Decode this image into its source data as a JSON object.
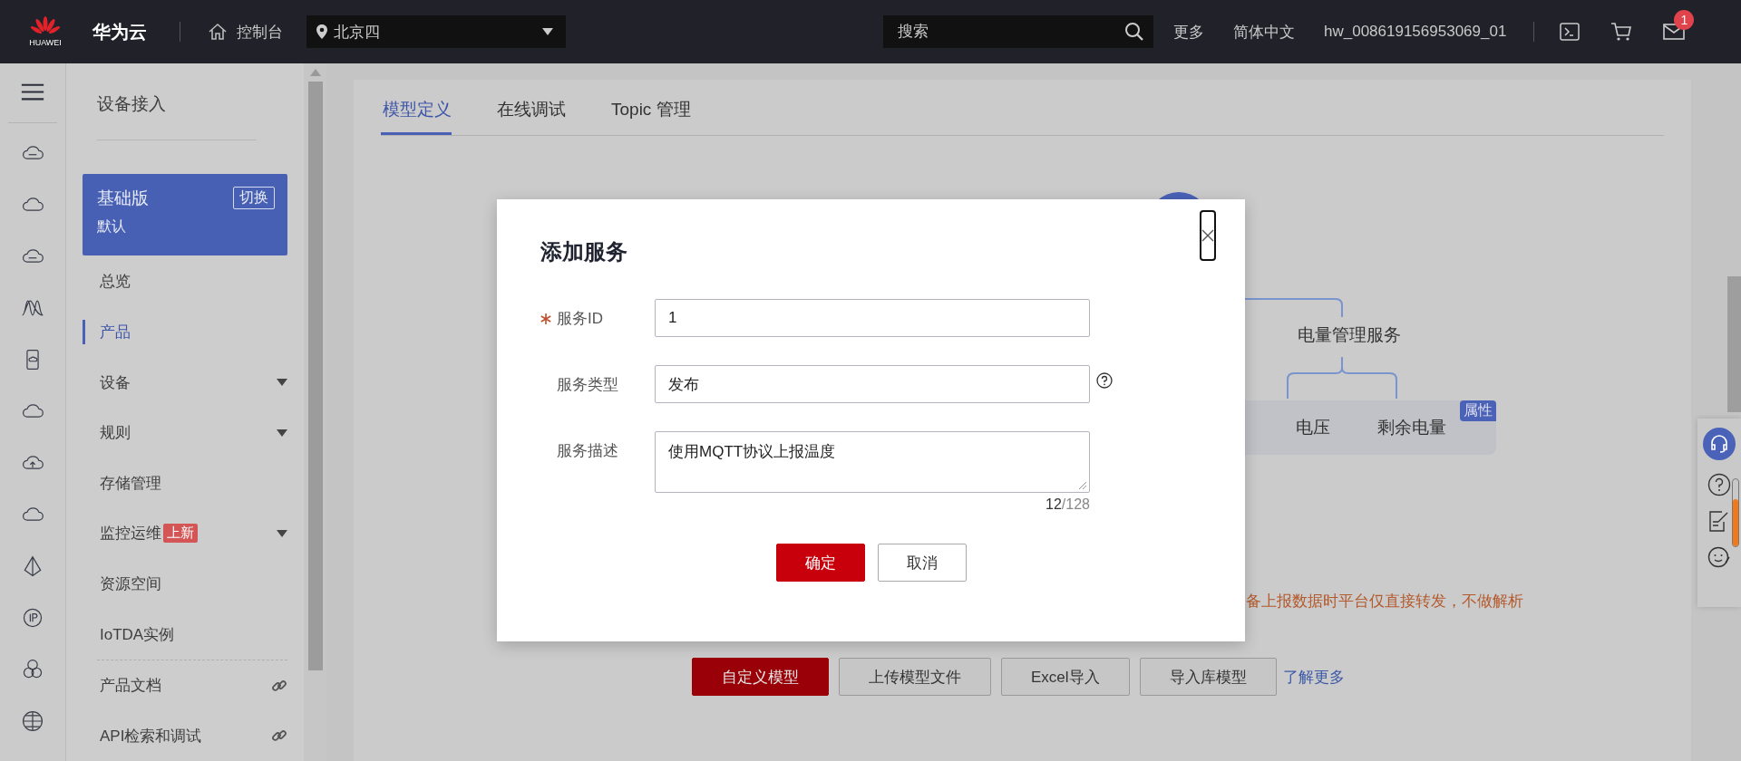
{
  "top_bar": {
    "logo_text": "HUAWEI",
    "brand": "华为云",
    "console": "控制台",
    "region": "北京四",
    "search": {
      "placeholder": "搜索"
    },
    "links": [
      "更多",
      "简体中文",
      "hw_008619156953069_01"
    ],
    "notification_count": "1"
  },
  "nav": {
    "title": "设备接入",
    "edition": {
      "name": "基础版",
      "switch": "切换",
      "instance": "默认"
    },
    "items": [
      {
        "label": "总览",
        "kind": "plain",
        "selected": false
      },
      {
        "label": "产品",
        "kind": "plain",
        "selected": true
      },
      {
        "label": "设备",
        "kind": "dropdown",
        "selected": false
      },
      {
        "label": "规则",
        "kind": "dropdown",
        "selected": false
      },
      {
        "label": "存储管理",
        "kind": "plain",
        "selected": false
      },
      {
        "label": "监控运维",
        "kind": "dropdown",
        "badge": "上新",
        "selected": false
      },
      {
        "label": "资源空间",
        "kind": "plain",
        "selected": false
      },
      {
        "label": "IoTDA实例",
        "kind": "plain",
        "selected": false
      },
      {
        "label": "产品文档",
        "kind": "link",
        "selected": false
      },
      {
        "label": "API检索和调试",
        "kind": "link",
        "selected": false
      }
    ]
  },
  "tabs": [
    {
      "label": "模型定义",
      "selected": true
    },
    {
      "label": "在线调试",
      "selected": false
    },
    {
      "label": "Topic 管理",
      "selected": false
    }
  ],
  "diagram": {
    "service": "电量管理服务",
    "properties": [
      "电压",
      "剩余电量"
    ],
    "badge": "属性"
  },
  "notice": "备上报数据时平台仅直接转发，不做解析",
  "actions": [
    {
      "label": "自定义模型",
      "kind": "primary"
    },
    {
      "label": "上传模型文件",
      "kind": "default"
    },
    {
      "label": "Excel导入",
      "kind": "default"
    },
    {
      "label": "导入库模型",
      "kind": "default"
    },
    {
      "label": "了解更多",
      "kind": "link"
    }
  ],
  "dialog": {
    "title": "添加服务",
    "fields": [
      {
        "label": "服务ID",
        "required": true,
        "kind": "input",
        "value": "1",
        "help": false
      },
      {
        "label": "服务类型",
        "required": false,
        "kind": "input",
        "value": "发布",
        "help": true
      },
      {
        "label": "服务描述",
        "required": false,
        "kind": "textarea",
        "value": "使用MQTT协议上报温度",
        "help": false,
        "count": "12",
        "limit": "/128"
      }
    ],
    "buttons": [
      {
        "label": "确定",
        "kind": "primary"
      },
      {
        "label": "取消",
        "kind": "default"
      }
    ]
  }
}
